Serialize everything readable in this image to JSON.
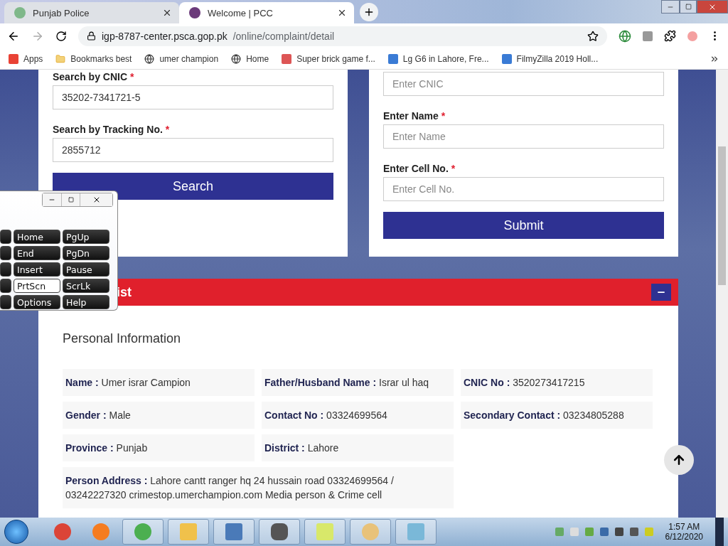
{
  "browser": {
    "tabs": [
      {
        "title": "Punjab Police",
        "selected": false
      },
      {
        "title": "Welcome | PCC",
        "selected": true
      }
    ],
    "url": {
      "host": "igp-8787-center.psca.gop.pk",
      "path": "/online/complaint/detail"
    },
    "bookmarks": [
      {
        "label": "Apps"
      },
      {
        "label": "Bookmarks best"
      },
      {
        "label": "umer champion"
      },
      {
        "label": "Home"
      },
      {
        "label": "Super brick game f..."
      },
      {
        "label": "Lg G6 in Lahore, Fre..."
      },
      {
        "label": "FilmyZilla 2019 Holl..."
      }
    ]
  },
  "search_form": {
    "fields": [
      {
        "label": "Search by CNIC",
        "required_mark": "*",
        "value": "35202-7341721-5"
      },
      {
        "label": "Search by Tracking No.",
        "required_mark": "*",
        "value": "2855712"
      }
    ],
    "button": "Search"
  },
  "submit_form": {
    "fields": [
      {
        "placeholder": "Enter CNIC"
      },
      {
        "label": "Enter Name",
        "required_mark": "*",
        "placeholder": "Enter Name"
      },
      {
        "label": "Enter Cell No.",
        "required_mark": "*",
        "placeholder": "Enter Cell No."
      }
    ],
    "button": "Submit"
  },
  "section": {
    "title": "ist",
    "expanded": true,
    "heading": "Personal Information",
    "fields": [
      {
        "label": "Name :",
        "value": "Umer israr Campion"
      },
      {
        "label": "Father/Husband Name :",
        "value": "Israr ul haq"
      },
      {
        "label": "CNIC No :",
        "value": "3520273417215"
      },
      {
        "label": "Gender :",
        "value": "Male"
      },
      {
        "label": "Contact No :",
        "value": "03324699564"
      },
      {
        "label": "Secondary Contact :",
        "value": "03234805288"
      },
      {
        "label": "Province :",
        "value": "Punjab"
      },
      {
        "label": "District :",
        "value": "Lahore"
      },
      {
        "label": "Person Address :",
        "value": "Lahore cantt ranger hq 24 hussain road 03324699564 / 03242227320 crimestop.umerchampion.com Media person & Crime cell",
        "wide": true
      }
    ]
  },
  "keyboard": {
    "rows": [
      [
        {
          "label": "Home",
          "selected": false
        },
        {
          "label": "PgUp",
          "selected": false
        }
      ],
      [
        {
          "label": "End",
          "selected": false
        },
        {
          "label": "PgDn",
          "selected": false
        }
      ],
      [
        {
          "label": "Insert",
          "selected": false
        },
        {
          "label": "Pause",
          "selected": false
        }
      ],
      [
        {
          "label": "PrtScn",
          "selected": true
        },
        {
          "label": "ScrLk",
          "selected": false
        }
      ],
      [
        {
          "label": "Options",
          "selected": false
        },
        {
          "label": "Help",
          "selected": false
        }
      ]
    ]
  },
  "taskbar": {
    "time": "1:57 AM",
    "date": "6/12/2020"
  }
}
